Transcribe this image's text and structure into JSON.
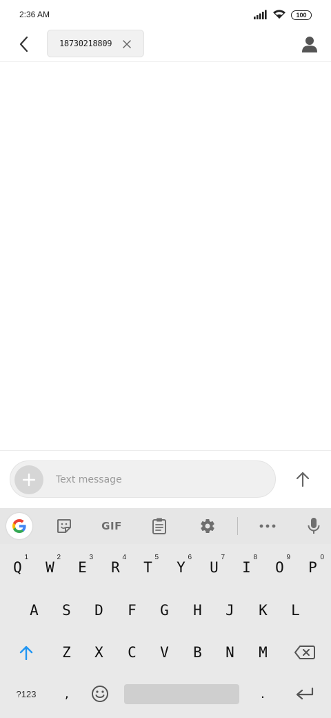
{
  "status": {
    "time": "2:36 AM",
    "battery": "100",
    "icons": [
      "signal-icon",
      "wifi-icon",
      "battery-icon"
    ]
  },
  "header": {
    "back_icon": "chevron-left-icon",
    "recipient": "18730218809",
    "remove_icon": "close-icon",
    "contact_icon": "person-icon"
  },
  "compose": {
    "placeholder": "Text message",
    "attach_icon": "plus-icon",
    "send_icon": "arrow-up-icon"
  },
  "keyboard": {
    "toolbar": {
      "gif_label": "GIF",
      "icons": [
        "google-icon",
        "sticker-icon",
        "clipboard-icon",
        "gear-icon",
        "more-icon",
        "mic-icon"
      ]
    },
    "row1": [
      {
        "label": "Q",
        "hint": "1"
      },
      {
        "label": "W",
        "hint": "2"
      },
      {
        "label": "E",
        "hint": "3"
      },
      {
        "label": "R",
        "hint": "4"
      },
      {
        "label": "T",
        "hint": "5"
      },
      {
        "label": "Y",
        "hint": "6"
      },
      {
        "label": "U",
        "hint": "7"
      },
      {
        "label": "I",
        "hint": "8"
      },
      {
        "label": "O",
        "hint": "9"
      },
      {
        "label": "P",
        "hint": "0"
      }
    ],
    "row2": [
      "A",
      "S",
      "D",
      "F",
      "G",
      "H",
      "J",
      "K",
      "L"
    ],
    "row3": [
      "Z",
      "X",
      "C",
      "V",
      "B",
      "N",
      "M"
    ],
    "symbols_label": "?123",
    "comma_label": ",",
    "period_label": ".",
    "accent_color": "#2196f3"
  }
}
